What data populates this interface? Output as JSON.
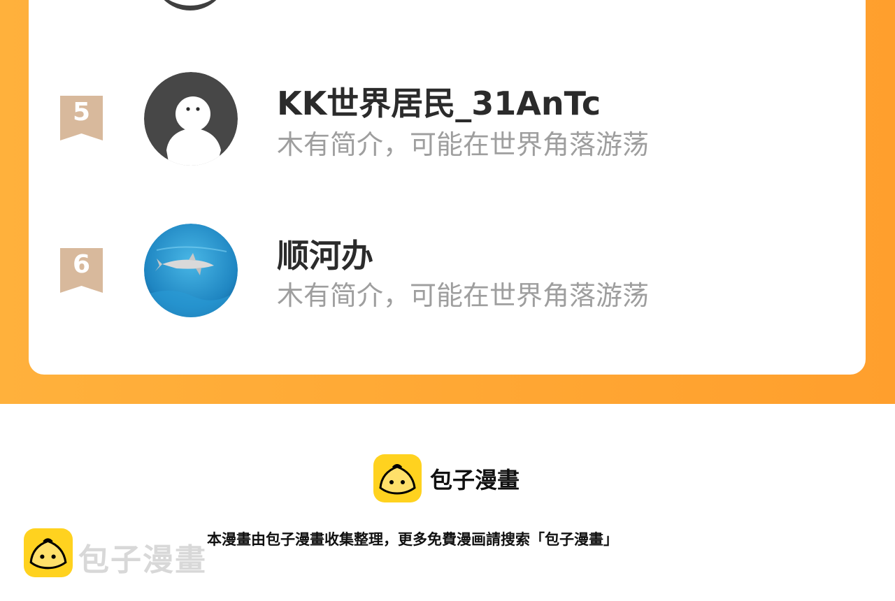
{
  "ranking": [
    {
      "rank": "5",
      "name": "KK世界居民_31AnTc",
      "bio": "木有简介，可能在世界角落游荡",
      "avatar": "default-user-avatar-icon"
    },
    {
      "rank": "6",
      "name": "顺河办",
      "bio": "木有简介，可能在世界角落游荡",
      "avatar": "shark-photo-avatar"
    }
  ],
  "brand": {
    "name": "包子漫畫",
    "logo": "bun-logo-icon"
  },
  "footer": {
    "notice": "本漫畫由包子漫畫收集整理，更多免費漫画請搜索「包子漫畫」"
  },
  "watermark": {
    "text": "包子漫畫",
    "logo": "bun-logo-icon"
  },
  "colors": {
    "accent": "#ff9f2d",
    "badge": "#d8b99c",
    "brand_yellow": "#ffd21f"
  }
}
